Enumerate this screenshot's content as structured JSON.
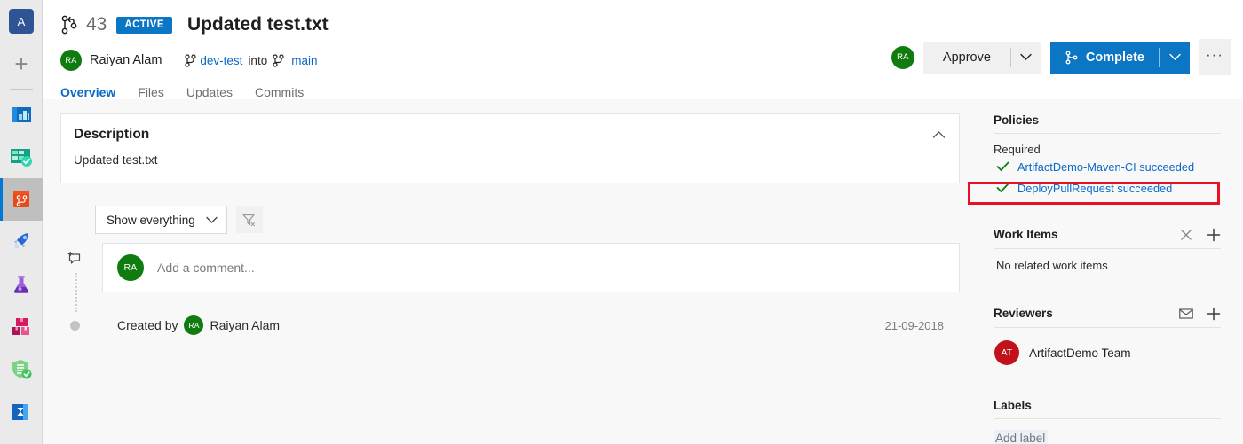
{
  "nav": {
    "org_initial": "A",
    "items": [
      {
        "name": "organization-badge",
        "label": "A"
      },
      {
        "name": "new-item",
        "label": "+"
      },
      {
        "name": "overview-boards",
        "label": "Overview"
      },
      {
        "name": "boards",
        "label": "Boards"
      },
      {
        "name": "repos",
        "label": "Repos"
      },
      {
        "name": "pipelines",
        "label": "Pipelines"
      },
      {
        "name": "test-plans",
        "label": "Test Plans"
      },
      {
        "name": "artifacts",
        "label": "Artifacts"
      },
      {
        "name": "security",
        "label": "Security"
      },
      {
        "name": "analytics",
        "label": "Analytics"
      }
    ]
  },
  "header": {
    "pr_number": "43",
    "status_badge": "ACTIVE",
    "title": "Updated test.txt",
    "author": "Raiyan Alam",
    "author_initials": "RA",
    "source_branch": "dev-test",
    "into_word": "into",
    "target_branch": "main",
    "tabs": [
      {
        "label": "Overview",
        "active": true
      },
      {
        "label": "Files",
        "active": false
      },
      {
        "label": "Updates",
        "active": false
      },
      {
        "label": "Commits",
        "active": false
      }
    ],
    "actions": {
      "reviewer_initials": "RA",
      "approve_label": "Approve",
      "complete_label": "Complete",
      "more_label": "···"
    }
  },
  "description": {
    "title": "Description",
    "body": "Updated test.txt"
  },
  "discussion": {
    "filter_value": "Show everything",
    "clear_filter_icon": "funnel-clear-icon",
    "comment_placeholder": "Add a comment...",
    "comment_avatar_initials": "RA",
    "created_by_label": "Created by",
    "created_by_name": "Raiyan Alam",
    "created_by_initials": "RA",
    "created_date": "21-09-2018"
  },
  "sidebar": {
    "policies": {
      "title": "Policies",
      "required_label": "Required",
      "items": [
        {
          "text": "ArtifactDemo-Maven-CI succeeded",
          "status": "succeeded",
          "highlighted": false
        },
        {
          "text": "DeployPullRequest succeeded",
          "status": "succeeded",
          "highlighted": true
        }
      ]
    },
    "work_items": {
      "title": "Work Items",
      "empty_text": "No related work items",
      "remove_icon": "close-icon",
      "add_icon": "plus-icon"
    },
    "reviewers": {
      "title": "Reviewers",
      "mail_icon": "envelope-icon",
      "add_icon": "plus-icon",
      "list": [
        {
          "name": "ArtifactDemo Team",
          "initials": "AT",
          "color": "#c1121c"
        }
      ]
    },
    "labels": {
      "title": "Labels",
      "add_label": "Add label"
    }
  },
  "colors": {
    "accent_blue": "#0b76c4",
    "link_blue": "#0b69c7",
    "success_green": "#107c10",
    "highlight_red": "#e81123",
    "avatar_green": "#107c10",
    "avatar_red": "#c1121c"
  }
}
